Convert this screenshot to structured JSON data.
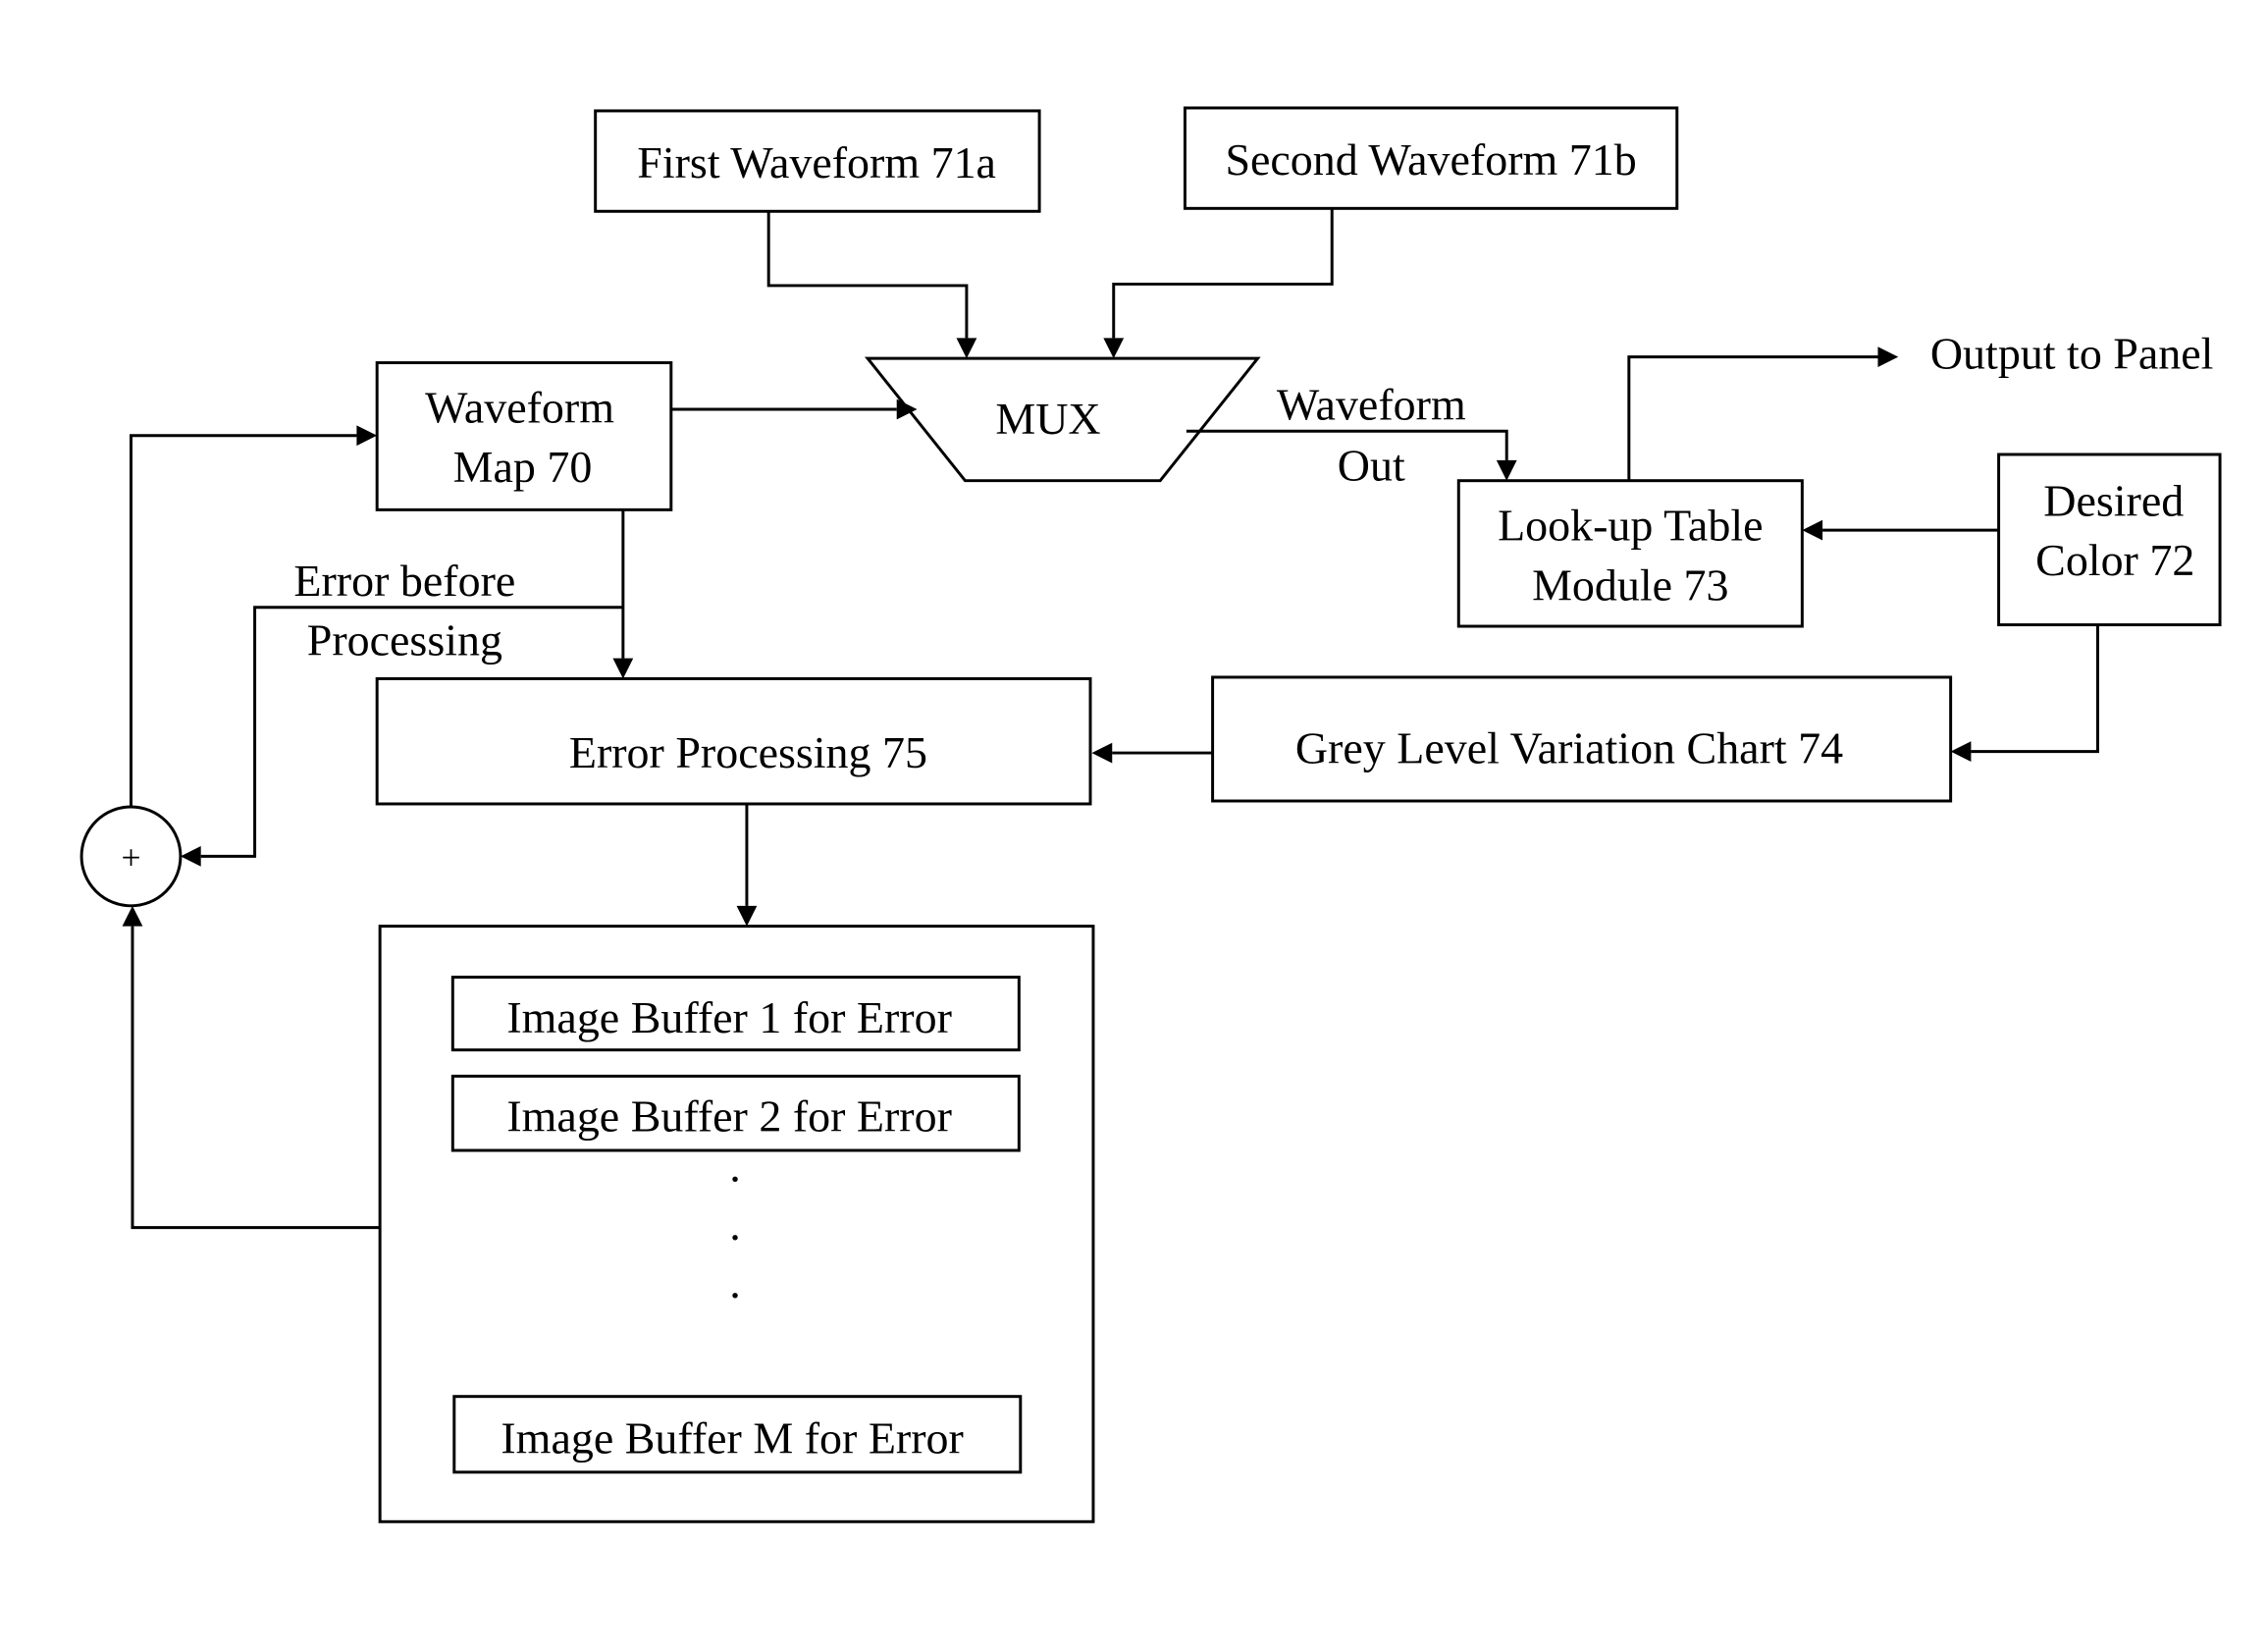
{
  "blocks": {
    "first_waveform": "First Waveform 71a",
    "second_waveform": "Second Waveform 71b",
    "waveform_map_1": "Waveform",
    "waveform_map_2": "Map 70",
    "mux": "MUX",
    "waveform_out_1": "Waveform",
    "waveform_out_2": "Out",
    "output_to_panel": "Output to Panel",
    "lut_1": "Look-up Table",
    "lut_2": "Module 73",
    "desired_color_1": "Desired",
    "desired_color_2": "Color 72",
    "error_before_1": "Error before",
    "error_before_2": "Processing",
    "error_processing": "Error Processing 75",
    "grey_level_chart": "Grey Level Variation Chart 74",
    "adder_symbol": "+",
    "buffer_1": "Image Buffer 1 for Error",
    "buffer_2": "Image Buffer 2 for Error",
    "buffer_m": "Image Buffer M for Error",
    "ellipsis": "·"
  }
}
